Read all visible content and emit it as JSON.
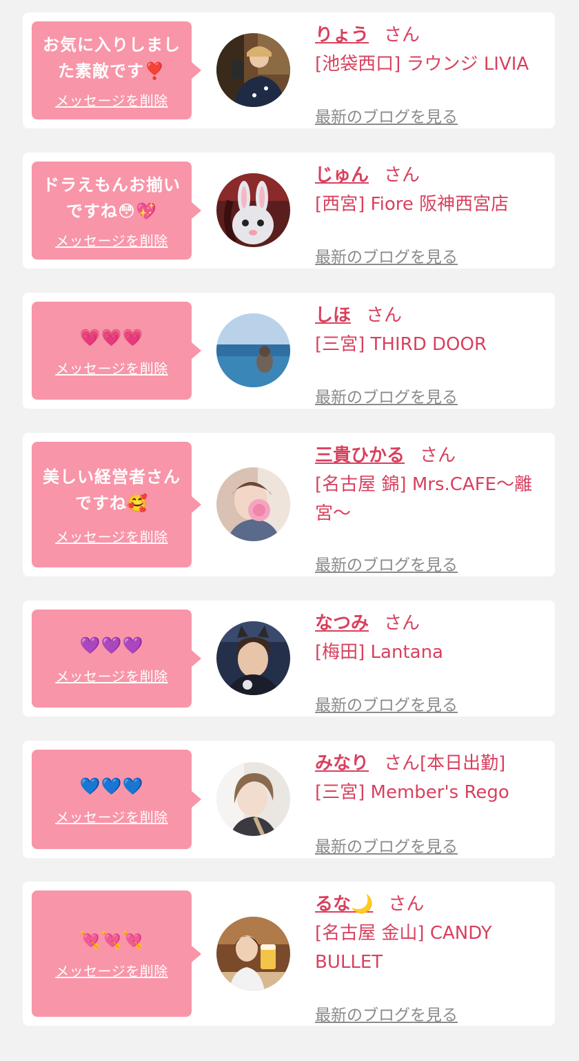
{
  "favorites": [
    {
      "message": "お気に入りしまし\nた素敵です❣️",
      "delete_label": "メッセージを削除",
      "name": "りょう",
      "suffix": "さん",
      "shop": "[池袋西口] ラウンジ LIVIA",
      "blog_label": "最新のブログを見る"
    },
    {
      "message": "ドラえもんお揃い\nですね😳💖",
      "delete_label": "メッセージを削除",
      "name": "じゅん",
      "suffix": "さん",
      "shop": "[西宮] Fiore 阪神西宮店",
      "blog_label": "最新のブログを見る"
    },
    {
      "message": "💗💗💗",
      "delete_label": "メッセージを削除",
      "name": "しほ",
      "suffix": "さん",
      "shop": "[三宮] THIRD DOOR",
      "blog_label": "最新のブログを見る"
    },
    {
      "message": "美しい経営者さん\nですね🥰",
      "delete_label": "メッセージを削除",
      "name": "三貴ひかる",
      "suffix": "さん",
      "shop": "[名古屋 錦] Mrs.CAFE〜離宮〜",
      "blog_label": "最新のブログを見る"
    },
    {
      "message": "💜💜💜",
      "delete_label": "メッセージを削除",
      "name": "なつみ",
      "suffix": "さん",
      "shop": "[梅田] Lantana",
      "blog_label": "最新のブログを見る"
    },
    {
      "message": "💙💙💙",
      "delete_label": "メッセージを削除",
      "name": "みなり",
      "suffix": "さん[本日出勤]",
      "shop": "[三宮] Member's Rego",
      "blog_label": "最新のブログを見る"
    },
    {
      "message": "💘💘💘",
      "delete_label": "メッセージを削除",
      "name": "るな🌙",
      "suffix": "さん",
      "shop": "[名古屋 金山] CANDY BULLET",
      "blog_label": "最新のブログを見る"
    }
  ],
  "colors": {
    "bubble": "#f895a8",
    "accent": "#d8405e",
    "muted": "#8a8a8a",
    "background": "#f2f2f2"
  }
}
